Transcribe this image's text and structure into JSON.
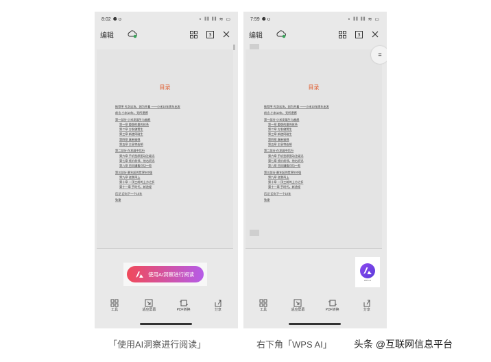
{
  "left_phone": {
    "status": {
      "time": "8:02",
      "icons": "⋆ ǁǁ ǁǁ ≋ ▭"
    },
    "toolbar": {
      "edit_label": "编辑"
    },
    "document": {
      "title": "目录",
      "toc": [
        {
          "text": "推荐序 孔剑这块，因为开着 ——小米10年周年出发",
          "level": 0
        },
        {
          "text": "前言 小米10年，无所遗憾",
          "level": 0
        },
        {
          "text": "第一部分 小米发展生与越趋",
          "level": 0
        },
        {
          "text": "第一章 重塑的量的体系",
          "level": 1
        },
        {
          "text": "第二章 方发佛赞生",
          "level": 1
        },
        {
          "text": "第三章 新使同碰生",
          "level": 1
        },
        {
          "text": "第四章 真新留挑",
          "level": 1
        },
        {
          "text": "第五章 主息特处顿",
          "level": 1
        },
        {
          "text": "第二部分 在发展中后行",
          "level": 0
        },
        {
          "text": "第六章 手机型原图动注级迅",
          "level": 1
        },
        {
          "text": "第七章 低价前领，他右初迅",
          "level": 1
        },
        {
          "text": "第八章 目风嫌看问功一寿",
          "level": 1
        },
        {
          "text": "第三部分 最年起的世界500强",
          "level": 0
        },
        {
          "text": "第九章 逆我再上",
          "level": 1
        },
        {
          "text": "第十章 一顶三前的上方之折",
          "level": 1
        },
        {
          "text": "第十一章 手时代，新途程",
          "level": 1
        },
        {
          "text": "后记 迈向下一个10年",
          "level": 0
        },
        {
          "text": "致谢",
          "level": 0
        }
      ]
    },
    "ai_button_label": "使用AI洞察进行阅读",
    "bottom_bar": [
      {
        "label": "工具",
        "icon": "grid-icon"
      },
      {
        "label": "适应屏幕",
        "icon": "fit-screen-icon"
      },
      {
        "label": "PDF转换",
        "icon": "pdf-convert-icon"
      },
      {
        "label": "分享",
        "icon": "share-icon"
      }
    ]
  },
  "right_phone": {
    "status": {
      "time": "7:59",
      "icons": "⋆ ǁǁ ǁǁ ≋ ▭"
    },
    "toolbar": {
      "edit_label": "编辑"
    },
    "document": {
      "title": "目录",
      "toc": [
        {
          "text": "推荐序 孔剑这块，因为开着 ——小米10年周年出发",
          "level": 0
        },
        {
          "text": "前言 小米10年，无所遗憾",
          "level": 0
        },
        {
          "text": "第一部分 小米发展生与越趋",
          "level": 0
        },
        {
          "text": "第一章 重塑的量的体系",
          "level": 1
        },
        {
          "text": "第二章 方发佛赞生",
          "level": 1
        },
        {
          "text": "第三章 新使同碰生",
          "level": 1
        },
        {
          "text": "第四章 真新留挑",
          "level": 1
        },
        {
          "text": "第五章 主息特处顿",
          "level": 1
        },
        {
          "text": "第二部分 在发展中后行",
          "level": 0
        },
        {
          "text": "第六章 手机型原图动注级迅",
          "level": 1
        },
        {
          "text": "第七章 低价前领，他右初迅",
          "level": 1
        },
        {
          "text": "第八章 目风嫌看问功一寿",
          "level": 1
        },
        {
          "text": "第三部分 最年起的世界500强",
          "level": 0
        },
        {
          "text": "第九章 逆我再上",
          "level": 1
        },
        {
          "text": "第十章 一顶三前的上方之折",
          "level": 1
        },
        {
          "text": "第十一章 手时代，新途程",
          "level": 1
        },
        {
          "text": "后记 迈向下一个10年",
          "level": 0
        },
        {
          "text": "致谢",
          "level": 0
        }
      ]
    },
    "wps_ai_caption": "WPS AI",
    "bottom_bar": [
      {
        "label": "工具",
        "icon": "grid-icon"
      },
      {
        "label": "适应屏幕",
        "icon": "fit-screen-icon"
      },
      {
        "label": "PDF转换",
        "icon": "pdf-convert-icon"
      },
      {
        "label": "分享",
        "icon": "share-icon"
      }
    ]
  },
  "captions": {
    "left": "「使用AI洞察进行阅读」",
    "right": "右下角「WPS AI」",
    "watermark": "头条 @互联网信息平台"
  },
  "colors": {
    "toc_title": "#e05a2b",
    "ai_gradient_start": "#f04a5a",
    "ai_gradient_end": "#b55ce8",
    "wps_ai_purple": "#7b43e8",
    "cloud_sync_green": "#3aa35b"
  }
}
